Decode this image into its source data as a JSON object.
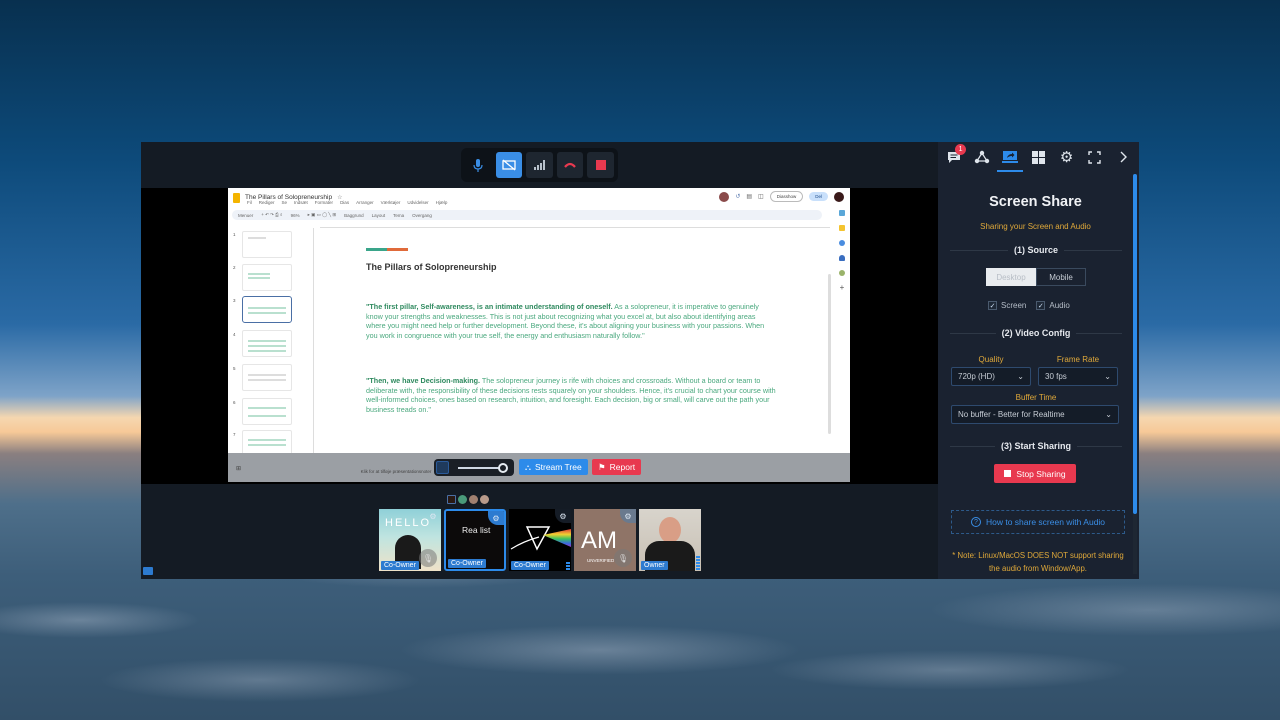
{
  "control_bar": {
    "buttons": [
      {
        "name": "microphone",
        "icon": "mic-icon",
        "color": "#3a8ee6"
      },
      {
        "name": "camera-off",
        "icon": "camera-off-icon",
        "color": "#3a8ee6"
      },
      {
        "name": "connection-stats",
        "icon": "signal-icon",
        "color": "#b8c2cc"
      },
      {
        "name": "hang-up",
        "icon": "phone-hangup-icon",
        "color": "#e8394f"
      },
      {
        "name": "stop-recording",
        "icon": "stop-icon",
        "color": "#e8394f"
      }
    ]
  },
  "shared_screen": {
    "doc_title": "The Pillars of Solopreneurship",
    "menus": [
      "Fil",
      "Rediger",
      "Se",
      "Indsæt",
      "Formater",
      "Dias",
      "Arranger",
      "Værktøjer",
      "Udvidelser",
      "Hjælp"
    ],
    "toolbar": [
      "Menuer",
      "96%",
      "Baggrund",
      "Layout",
      "Tema",
      "Overgang"
    ],
    "slideshow_label": "Diasshow",
    "share_label": "Del",
    "thumbnail_numbers": [
      "1",
      "2",
      "3",
      "4",
      "5",
      "6",
      "7"
    ],
    "selected_slide": 3,
    "slide": {
      "title": "The Pillars of Solopreneurship",
      "paragraph1_bold": "\"The first pillar, Self-awareness, is an intimate understanding of oneself.",
      "paragraph1_rest": " As a solopreneur, it is imperative to genuinely know your strengths and weaknesses. This is not just about recognizing what you excel at, but also about identifying areas where you might need help or further development. Beyond these, it's about aligning your business with your passions. When you work in congruence with your true self, the energy and enthusiasm naturally follow.\"",
      "paragraph2_bold": "\"Then, we have Decision-making.",
      "paragraph2_rest": " The solopreneur journey is rife with choices and crossroads. Without a board or team to deliberate with, the responsibility of these decisions rests squarely on your shoulders. Hence, it's crucial to chart your course with well-informed choices, ones based on research, intuition, and foresight. Each decision, big or small, will carve out the path your business treads on.\""
    },
    "speaker_notes_placeholder": "Klik for at tilføje præsentationsnoter"
  },
  "stream_controls": {
    "volume_percent": 100,
    "stream_tree_label": "Stream Tree",
    "report_label": "Report"
  },
  "participants": [
    {
      "role": "Co-Owner",
      "content": "HELLO",
      "muted": true,
      "selected": false
    },
    {
      "role": "Co-Owner",
      "content": "Rea list",
      "muted": false,
      "selected": true
    },
    {
      "role": "Co-Owner",
      "content": "",
      "muted": false,
      "selected": false
    },
    {
      "role": "",
      "content": "AM",
      "subtitle": "UNVERIFIED",
      "muted": true,
      "selected": false
    },
    {
      "role": "Owner",
      "content": "",
      "muted": false,
      "selected": false
    }
  ],
  "panel": {
    "tabs": [
      {
        "icon": "chat-icon",
        "badge": "1"
      },
      {
        "icon": "network-icon"
      },
      {
        "icon": "screen-share-icon",
        "active": true
      },
      {
        "icon": "grid-icon"
      },
      {
        "icon": "gear-icon"
      },
      {
        "icon": "fullscreen-icon"
      },
      {
        "icon": "chevron-right-icon"
      }
    ],
    "title": "Screen Share",
    "subtitle": "Sharing your Screen and Audio",
    "source_heading": "(1) Source",
    "source_options": [
      "Desktop",
      "Mobile"
    ],
    "source_selected": "Desktop",
    "screen_label": "Screen",
    "screen_checked": true,
    "audio_label": "Audio",
    "audio_checked": true,
    "video_heading": "(2) Video Config",
    "quality_label": "Quality",
    "quality_value": "720p (HD)",
    "framerate_label": "Frame Rate",
    "framerate_value": "30 fps",
    "buffer_label": "Buffer Time",
    "buffer_value": "No buffer - Better for Realtime",
    "start_heading": "(3) Start Sharing",
    "stop_label": "Stop Sharing",
    "howto_label": "How to share screen with Audio",
    "note": "* Note: Linux/MacOS DOES NOT support sharing the audio from Window/App."
  }
}
